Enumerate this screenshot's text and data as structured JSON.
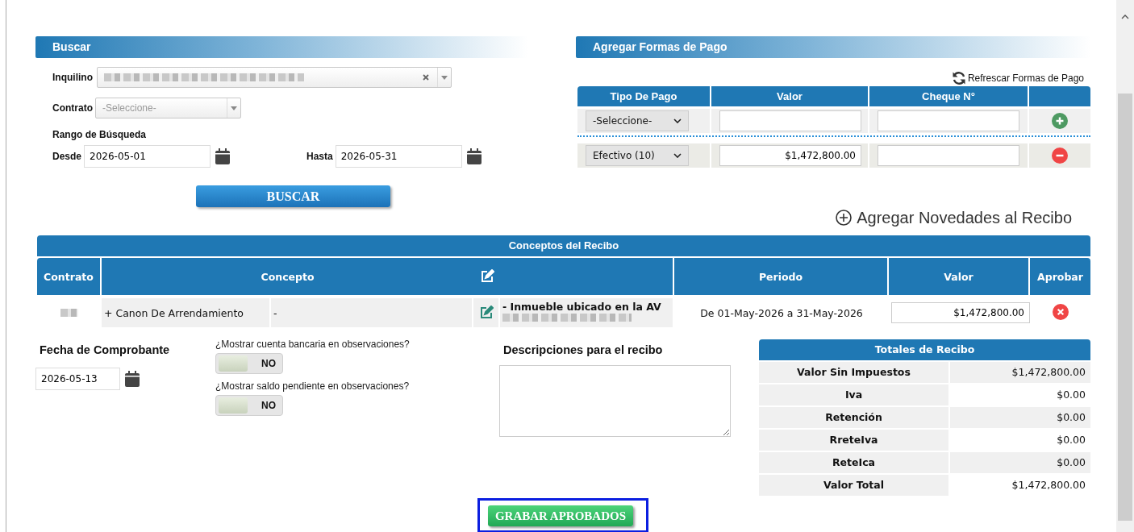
{
  "search_panel": {
    "title": "Buscar",
    "tenant": {
      "label": "Inquilino"
    },
    "contract": {
      "label": "Contrato",
      "placeholder": "-Seleccione-"
    },
    "range_label": "Rango de Búsqueda",
    "from": {
      "label": "Desde",
      "value": "2026-05-01"
    },
    "to": {
      "label": "Hasta",
      "value": "2026-05-31"
    },
    "button": "BUSCAR"
  },
  "payment_panel": {
    "title": "Agregar Formas de Pago",
    "refresh_link": "Refrescar Formas de Pago",
    "columns": [
      "Tipo De Pago",
      "Valor",
      "Cheque N°"
    ],
    "rows": [
      {
        "kind": "new",
        "type": "-Seleccione-"
      },
      {
        "kind": "entry",
        "type": "Efectivo (10)",
        "value": "$1,472,800.00"
      }
    ]
  },
  "add_news_link": "Agregar Novedades al Recibo",
  "concepts": {
    "title": "Conceptos del Recibo",
    "columns": {
      "contract": "Contrato",
      "concept": "Concepto",
      "period": "Periodo",
      "value": "Valor",
      "approve": "Aprobar"
    },
    "rows": [
      {
        "concept": "+ Canon De Arrendamiento",
        "detail": "-",
        "description": "- Inmueble ubicado en la AV",
        "period": "De 01-May-2026 a 31-May-2026",
        "value": "$1,472,800.00",
        "approved": false
      }
    ]
  },
  "voucher_date": {
    "label": "Fecha de Comprobante",
    "value": "2026-05-13"
  },
  "options": [
    {
      "label": "¿Mostrar cuenta bancaria en observaciones?",
      "state_text": "NO",
      "on": false
    },
    {
      "label": "¿Mostrar saldo pendiente en observaciones?",
      "state_text": "NO",
      "on": false
    }
  ],
  "descriptions": {
    "label": "Descripciones para el recibo"
  },
  "totals": {
    "title": "Totales de Recibo",
    "rows": [
      {
        "label": "Valor Sin Impuestos",
        "value": "$1,472,800.00"
      },
      {
        "label": "Iva",
        "value": "$0.00"
      },
      {
        "label": "Retención",
        "value": "$0.00"
      },
      {
        "label": "RreteIva",
        "value": "$0.00"
      },
      {
        "label": "ReteIca",
        "value": "$0.00"
      },
      {
        "label": "Valor Total",
        "value": "$1,472,800.00"
      }
    ]
  },
  "save_button": {
    "label": "GRABAR APROBADOS",
    "highlighted": true
  }
}
